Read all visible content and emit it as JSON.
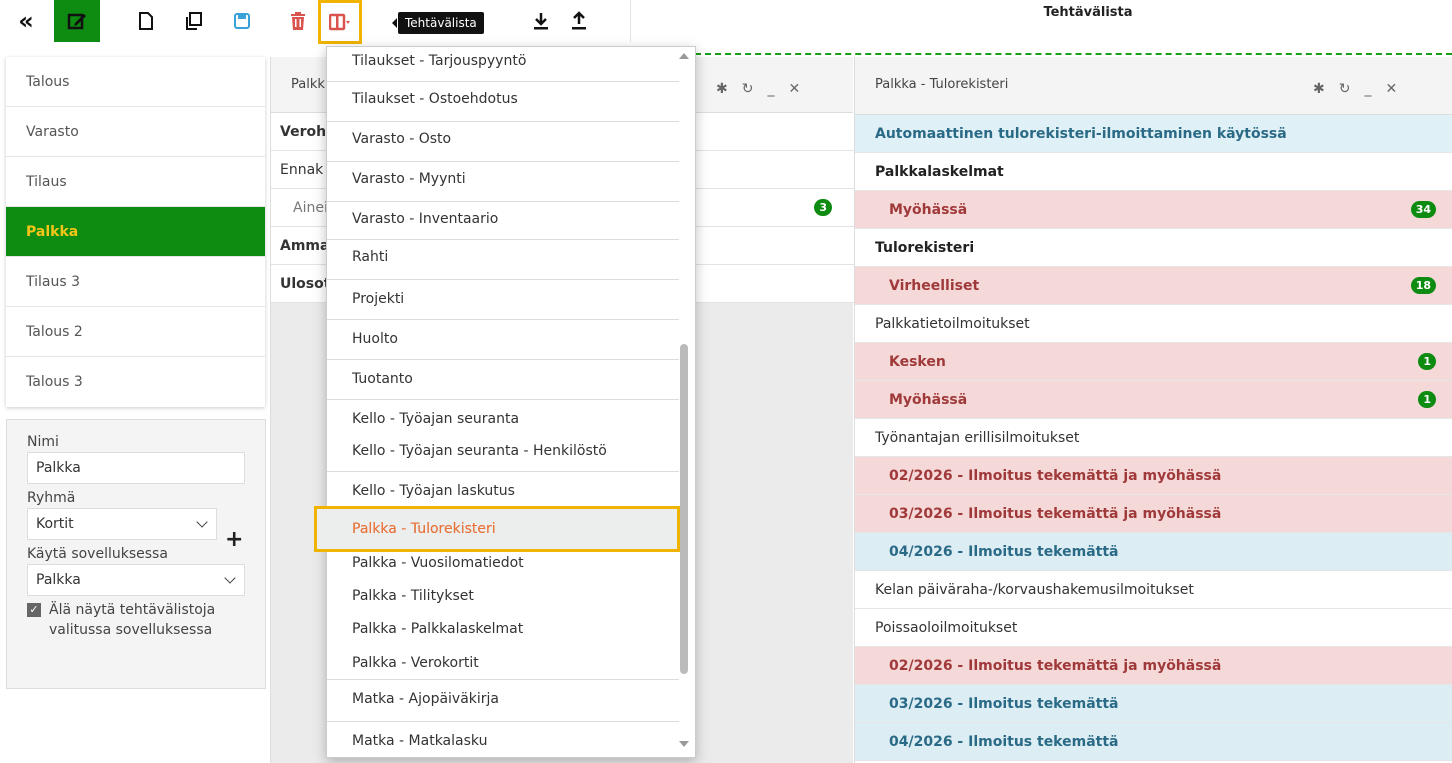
{
  "toolbar": {
    "tooltip": "Tehtävälista",
    "page_title": "Tehtävälista"
  },
  "apps": [
    "Talous",
    "Varasto",
    "Tilaus",
    "Palkka",
    "Tilaus 3",
    "Talous 2",
    "Talous 3"
  ],
  "form": {
    "name_label": "Nimi",
    "name_value": "Palkka",
    "group_label": "Ryhmä",
    "group_value": "Kortit",
    "use_label": "Käytä sovelluksessa",
    "use_value": "Palkka",
    "checkbox_line1": "Älä näytä tehtävälistoja",
    "checkbox_line2": "valitussa sovelluksessa",
    "checkbox_checked": true
  },
  "panel_left": {
    "title": "Palkk",
    "rows": [
      {
        "label": "Veroh",
        "bold": true
      },
      {
        "label": "Ennak",
        "bold": false
      },
      {
        "label": "Ainei",
        "bold": false,
        "badge": "3"
      },
      {
        "label": "Amma",
        "bold": true
      },
      {
        "label": "Ulosot",
        "bold": true
      }
    ]
  },
  "dropdown": {
    "items": [
      "Tilaukset - Tarjouspyyntö",
      "Tilaukset - Ostoehdotus",
      "Varasto - Osto",
      "Varasto - Myynti",
      "Varasto - Inventaario",
      "Rahti",
      "Projekti",
      "Huolto",
      "Tuotanto",
      "Kello - Työajan seuranta",
      "Kello - Työajan seuranta - Henkilöstö",
      "Kello - Työajan laskutus",
      "Palkka - Tulorekisteri",
      "Palkka - Vuosilomatiedot",
      "Palkka - Tilitykset",
      "Palkka - Palkkalaskelmat",
      "Palkka - Verokortit",
      "Matka - Ajopäiväkirja",
      "Matka - Matkalasku"
    ],
    "selected": "Palkka - Tulorekisteri"
  },
  "panel_right": {
    "title": "Palkka - Tulorekisteri",
    "rows": [
      {
        "label": "Automaattinen tulorekisteri-ilmoittaminen käytössä",
        "kind": "info"
      },
      {
        "label": "Palkkalaskelmat",
        "kind": "hd"
      },
      {
        "label": "Myöhässä",
        "kind": "red",
        "badge": "34"
      },
      {
        "label": "Tulorekisteri",
        "kind": "hd"
      },
      {
        "label": "Virheelliset",
        "kind": "red",
        "badge": "18"
      },
      {
        "label": "Palkkatietoilmoitukset",
        "kind": "plain"
      },
      {
        "label": "Kesken",
        "kind": "red",
        "badge": "1"
      },
      {
        "label": "Myöhässä",
        "kind": "red",
        "badge": "1"
      },
      {
        "label": "Työnantajan erillisilmoitukset",
        "kind": "plain"
      },
      {
        "label": "02/2026 - Ilmoitus tekemättä ja myöhässä",
        "kind": "red"
      },
      {
        "label": "03/2026 - Ilmoitus tekemättä ja myöhässä",
        "kind": "red"
      },
      {
        "label": "04/2026 - Ilmoitus tekemättä",
        "kind": "blue"
      },
      {
        "label": "Kelan päiväraha-/korvaushakemusilmoitukset",
        "kind": "plain"
      },
      {
        "label": "Poissaoloilmoitukset",
        "kind": "plain"
      },
      {
        "label": "02/2026 - Ilmoitus tekemättä ja myöhässä",
        "kind": "red"
      },
      {
        "label": "03/2026 - Ilmoitus tekemättä",
        "kind": "blue"
      },
      {
        "label": "04/2026 - Ilmoitus tekemättä",
        "kind": "blue"
      }
    ]
  },
  "colors": {
    "accent_green": "#0e8c12",
    "highlight_yellow": "#f0b400",
    "selected_text": "#e8743c",
    "delete_red": "#d9534f",
    "save_blue": "#3aa0d8"
  },
  "icons": {
    "collapse": "double-chevron-left-icon",
    "edit": "edit-icon",
    "new": "new-document-icon",
    "copy": "copy-icon",
    "save": "save-icon",
    "delete": "trash-icon",
    "layout": "column-layout-icon",
    "download": "download-icon",
    "upload": "upload-icon",
    "gear": "gear-icon",
    "refresh": "refresh-icon",
    "minimize": "minimize-icon",
    "close": "close-icon"
  }
}
